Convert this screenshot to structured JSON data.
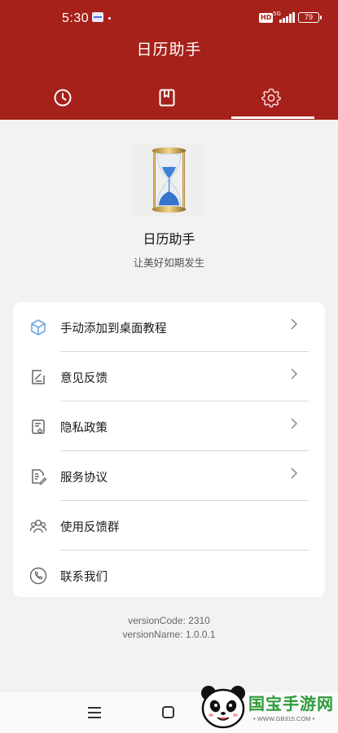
{
  "status_bar": {
    "time": "5:30",
    "hd_label": "HD",
    "network_label": "5G",
    "battery": "79"
  },
  "header": {
    "title": "日历助手",
    "tabs": [
      {
        "icon": "clock-icon"
      },
      {
        "icon": "bookmark-icon"
      },
      {
        "icon": "settings-icon",
        "active": true
      }
    ]
  },
  "app_info": {
    "logo_icon": "hourglass-icon",
    "name": "日历助手",
    "slogan": "让美好如期发生"
  },
  "menu": {
    "items": [
      {
        "label": "手动添加到桌面教程",
        "icon": "cube-icon",
        "chevron": true
      },
      {
        "label": "意见反馈",
        "icon": "feedback-icon",
        "chevron": true
      },
      {
        "label": "隐私政策",
        "icon": "privacy-icon",
        "chevron": true
      },
      {
        "label": "服务协议",
        "icon": "agreement-icon",
        "chevron": true
      },
      {
        "label": "使用反馈群",
        "icon": "group-icon",
        "chevron": false
      },
      {
        "label": "联系我们",
        "icon": "phone-icon",
        "chevron": false
      }
    ]
  },
  "version": {
    "code": "versionCode: 2310",
    "name": "versionName: 1.0.0.1"
  },
  "watermark": {
    "text": "国宝手游网",
    "url": "• WWW.GB315.COM •"
  },
  "colors": {
    "header_bg": "#a6211a",
    "page_bg": "#f2f2f2",
    "card_bg": "#ffffff"
  }
}
